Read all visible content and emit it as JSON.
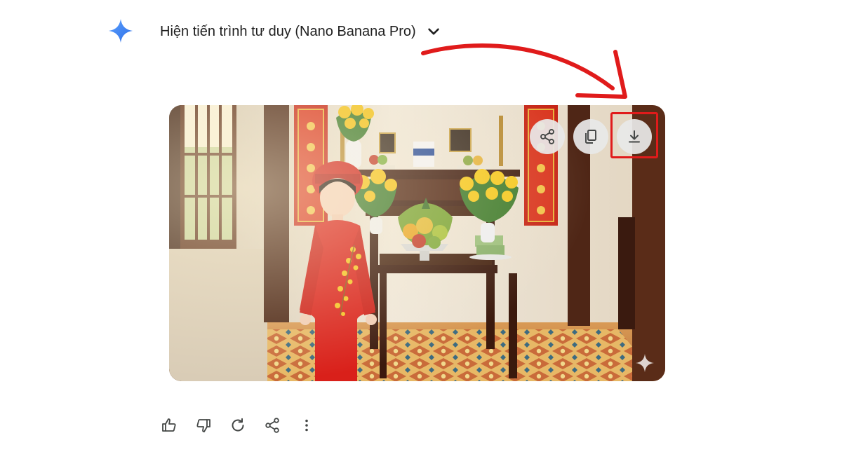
{
  "header": {
    "thinking_label": "Hiện tiến trình tư duy (Nano Banana Pro)"
  },
  "icons": {
    "logo": "gemini-sparkle-icon",
    "expand": "chevron-down-icon",
    "image_actions": [
      "share-icon",
      "copy-icon",
      "download-icon"
    ],
    "response_actions": [
      "thumbs-up-icon",
      "thumbs-down-icon",
      "regenerate-icon",
      "share-icon",
      "more-vert-icon"
    ]
  },
  "colors": {
    "accent": "#4285f4",
    "annotation": "#e01b1b",
    "icon": "#444746"
  }
}
